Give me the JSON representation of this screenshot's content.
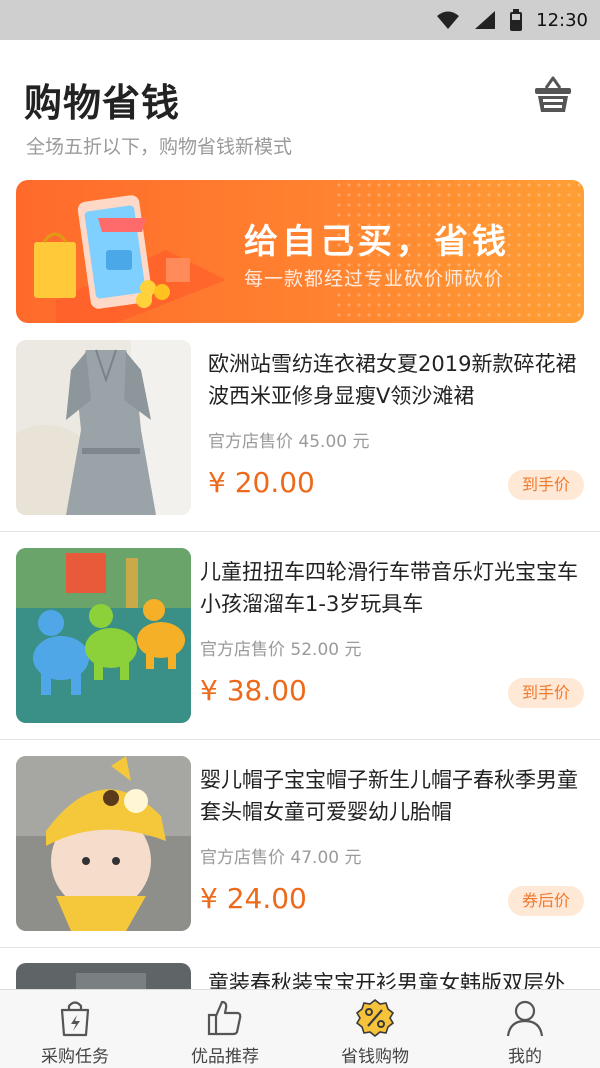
{
  "status_bar": {
    "time": "12:30",
    "icons": [
      "wifi-icon",
      "signal-icon",
      "battery-icon"
    ]
  },
  "header": {
    "title": "购物省钱",
    "subtitle": "全场五折以下，购物省钱新模式",
    "cart_icon": "basket-icon"
  },
  "banner": {
    "title": "给自己买，省钱",
    "subtitle": "每一款都经过专业砍价师砍价"
  },
  "products": [
    {
      "title": "欧洲站雪纺连衣裙女夏2019新款碎花裙波西米亚修身显瘦V领沙滩裙",
      "original": "官方店售价 45.00 元",
      "price": "¥ 20.00",
      "tag": "到手价"
    },
    {
      "title": "儿童扭扭车四轮滑行车带音乐灯光宝宝车小孩溜溜车1-3岁玩具车",
      "original": "官方店售价 52.00 元",
      "price": "¥ 38.00",
      "tag": "到手价"
    },
    {
      "title": "婴儿帽子宝宝帽子新生儿帽子春秋季男童套头帽女童可爱婴幼儿胎帽",
      "original": "官方店售价 47.00 元",
      "price": "¥ 24.00",
      "tag": "券后价"
    },
    {
      "title": "童装春秋装宝宝开衫男童女韩版双层外"
    }
  ],
  "tabs": [
    {
      "label": "采购任务",
      "icon": "shopping-bag-icon"
    },
    {
      "label": "优品推荐",
      "icon": "thumbs-up-icon"
    },
    {
      "label": "省钱购物",
      "icon": "discount-badge-icon"
    },
    {
      "label": "我的",
      "icon": "user-icon"
    }
  ],
  "colors": {
    "accent": "#ee6a1b",
    "banner_start": "#ff6a2b",
    "banner_end": "#ff9f35",
    "tag_bg": "#ffe8d6",
    "active_icon": "#f7c33a"
  }
}
